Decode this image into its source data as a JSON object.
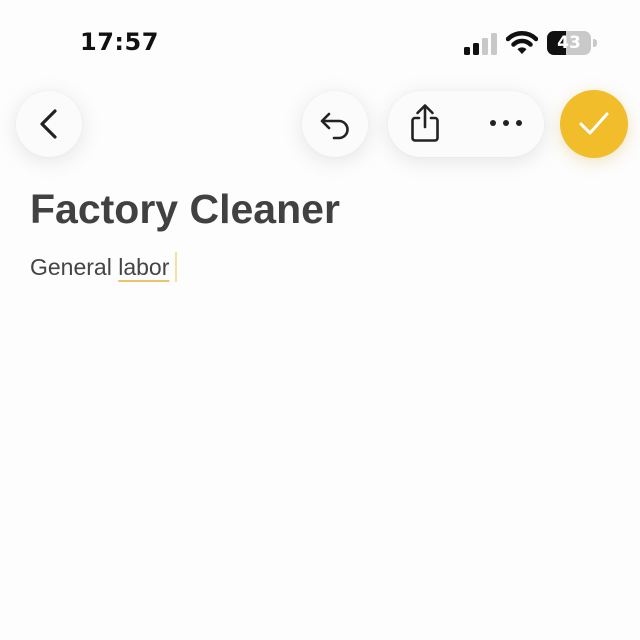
{
  "status_bar": {
    "time": "17:57",
    "battery_level": "43",
    "battery_fraction": 0.43,
    "signal_bars_active": 2,
    "signal_bars_total": 4,
    "icons": [
      "cellular-signal-icon",
      "wifi-icon",
      "battery-icon"
    ]
  },
  "toolbar": {
    "back_icon": "chevron-left-icon",
    "undo_icon": "undo-arrow-icon",
    "share_icon": "share-icon",
    "more_icon": "ellipsis-icon",
    "done_icon": "checkmark-icon"
  },
  "note": {
    "title": "Factory Cleaner",
    "body_plain": "General ",
    "body_underlined": "labor"
  },
  "colors": {
    "accent": "#f1bd2b",
    "underline": "#e9c46a",
    "text": "#414141",
    "background": "#fdfdfd"
  }
}
